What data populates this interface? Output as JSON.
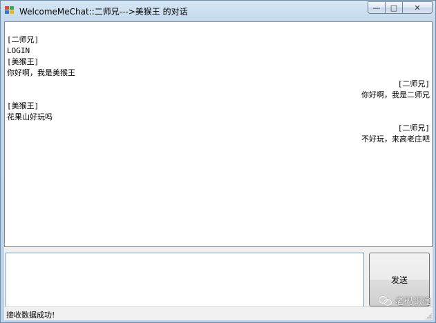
{
  "window": {
    "title": "WelcomeMeChat::二师兄--->美猴王 的对话",
    "min_glyph": "—",
    "max_glyph": "□",
    "close_glyph": "✕"
  },
  "chat": {
    "messages": [
      {
        "align": "left",
        "sender": "[二师兄]",
        "text": "LOGIN"
      },
      {
        "align": "left",
        "sender": "[美猴王]",
        "text": "你好啊，我是美猴王"
      },
      {
        "align": "right",
        "sender": "[二师兄]",
        "text": "你好啊，我是二师兄"
      },
      {
        "align": "left",
        "sender": "[美猴王]",
        "text": "花果山好玩吗"
      },
      {
        "align": "right",
        "sender": "[二师兄]",
        "text": "不好玩，来高老庄吧"
      }
    ]
  },
  "input": {
    "value": ""
  },
  "send_button": {
    "label": "发送"
  },
  "status": {
    "text": "接收数据成功!"
  },
  "watermark": {
    "text": "老码识途"
  },
  "colors": {
    "accent_border": "#6d8eaa",
    "icon_red": "#e04a2a",
    "icon_blue": "#2a78d0",
    "icon_green": "#3aa84a",
    "icon_yellow": "#f2b418"
  }
}
